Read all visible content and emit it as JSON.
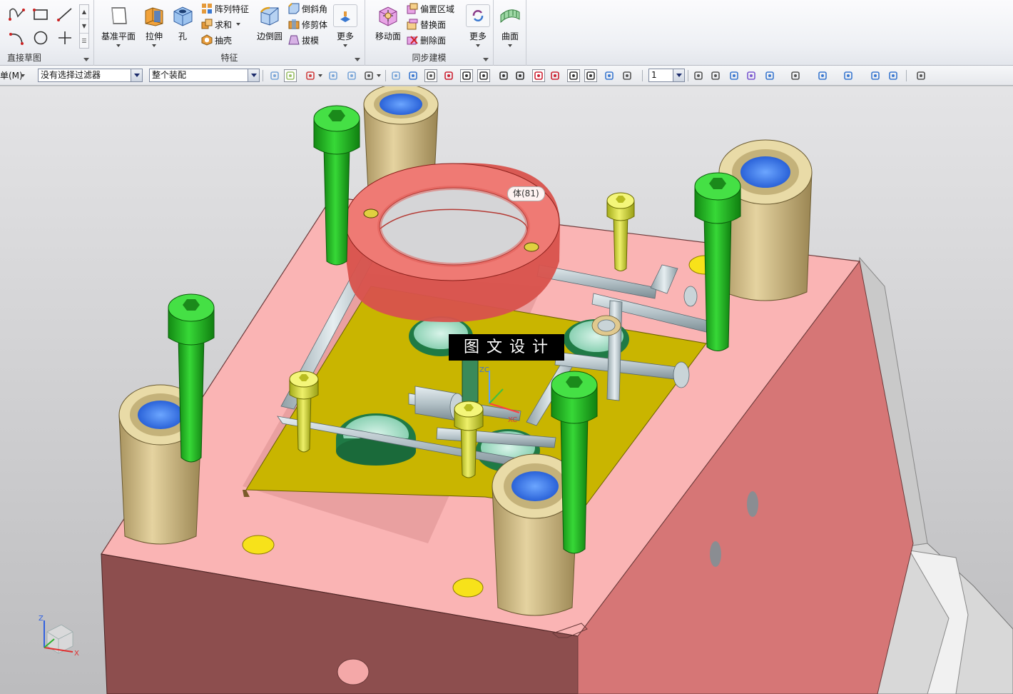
{
  "ribbon": {
    "direct_sketch": {
      "label": "直接草图"
    },
    "feature": {
      "label": "特征",
      "datum_plane": "基准平面",
      "extrude": "拉伸",
      "hole": "孔",
      "pattern_feature": "阵列特征",
      "unite": "求和",
      "shell": "抽壳",
      "edge_blend": "边倒圆",
      "chamfer": "倒斜角",
      "trim_body": "修剪体",
      "draft": "拔模",
      "more": "更多"
    },
    "sync": {
      "label": "同步建模",
      "move_face": "移动面",
      "offset_region": "偏置区域",
      "replace_face": "替换面",
      "delete_face": "删除面",
      "more": "更多"
    },
    "surface": {
      "label": "曲面"
    }
  },
  "selbar": {
    "menu_label": "单(M)",
    "filter_value": "没有选择过滤器",
    "scope_value": "整个装配",
    "layer_value": "1"
  },
  "viewport": {
    "tooltip": "体(81)",
    "watermark": "图文设计",
    "triad_labels": {
      "z": "Z",
      "x": "X"
    },
    "wcs_labels": {
      "zc": "ZC",
      "xc": "XC"
    }
  },
  "colors": {
    "plate_top": "#fab4b4",
    "plate_front": "#8d4e4e",
    "plate_right": "#d67676",
    "yellow_plate": "#c9b500",
    "green_bolt": "#22c122",
    "tan_bushing": "#d6c28e",
    "red_ring": "#e9706c",
    "pipe": "#b6c3c9"
  }
}
